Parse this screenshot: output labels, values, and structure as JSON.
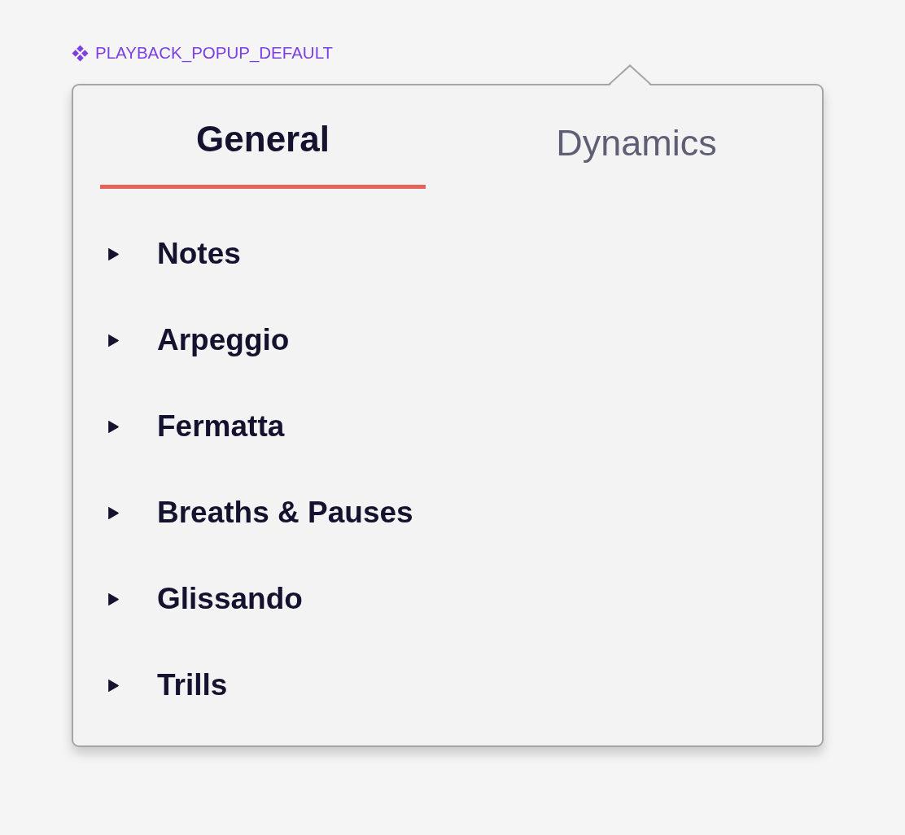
{
  "component_label": {
    "text": "PLAYBACK_POPUP_DEFAULT"
  },
  "popup": {
    "tabs": [
      {
        "label": "General",
        "selected": true
      },
      {
        "label": "Dynamics",
        "selected": false
      }
    ],
    "sections": [
      {
        "label": "Notes",
        "expanded": false
      },
      {
        "label": "Arpeggio",
        "expanded": false
      },
      {
        "label": "Fermatta",
        "expanded": false
      },
      {
        "label": "Breaths & Pauses",
        "expanded": false
      },
      {
        "label": "Glissando",
        "expanded": false
      },
      {
        "label": "Trills",
        "expanded": false
      }
    ]
  }
}
